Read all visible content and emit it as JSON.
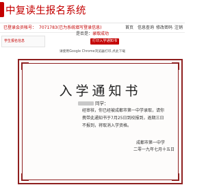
{
  "header": {
    "title": "中复读生报名系统"
  },
  "subbar": {
    "user_id": "已登录会员帐号：",
    "user_note": "7071783(已为系统填写登录信息)",
    "nav": [
      "首页",
      "信息查询",
      "修改密码",
      "注销"
    ]
  },
  "left_panel": {
    "text": "学生报名信息"
  },
  "status": {
    "label": "是否是：",
    "value": "录取成功"
  },
  "print_button": {
    "label": "打印入学通知书"
  },
  "tip": {
    "text": "请使用Google Chrome浏览器打印,点此下载",
    "link": "下载"
  },
  "notice": {
    "title": "入学通知书",
    "greeting_suffix": "同学：",
    "body": "经审核，你已经被成都市第一中学录取，请你携带此通知书于7月25日到校报到，逾期三日不报到，将取消入学资格。",
    "school": "成都市第一中学",
    "date": "二零一九年七月十五日"
  },
  "colors": {
    "accent": "#c40000",
    "border": "#8e1f1f"
  }
}
